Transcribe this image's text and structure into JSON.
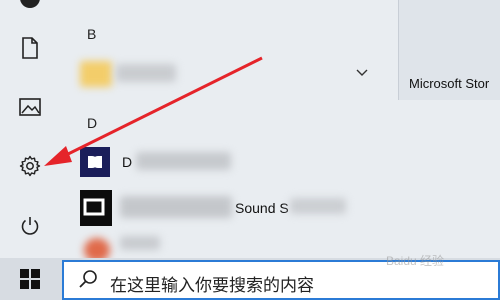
{
  "rail": {
    "icons": [
      "power-icon-partial",
      "document-icon",
      "pictures-icon",
      "gear-icon",
      "power-icon"
    ]
  },
  "applist": {
    "sections": [
      {
        "letter": "B"
      },
      {
        "letter": "D"
      }
    ],
    "apps": [
      {
        "name": "",
        "icon": "folder-icon",
        "expandable": true
      },
      {
        "name": "D",
        "icon": "dolby-icon"
      },
      {
        "name": "Sound S",
        "icon": "dts-icon"
      }
    ]
  },
  "tiles": [
    {
      "label": "Microsoft Stor"
    }
  ],
  "taskbar": {
    "search_placeholder": "在这里输入你要搜索的内容"
  },
  "watermark": "Baidu 经验",
  "colors": {
    "accent": "#2b7bd6",
    "arrow": "#e5242a"
  }
}
